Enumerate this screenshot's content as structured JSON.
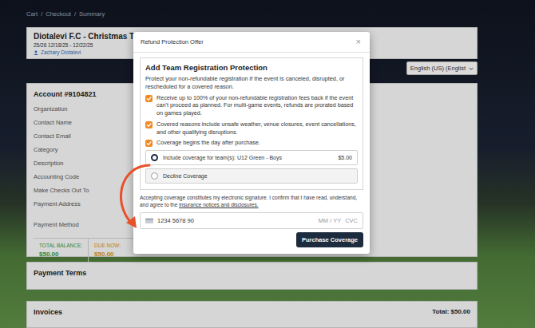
{
  "breadcrumb": {
    "items": [
      "Cart",
      "Checkout",
      "Summary"
    ],
    "separator": "/"
  },
  "event": {
    "title": "Diotalevi F.C - Christmas Tourn",
    "dates": "25/26 12/18/25 - 12/22/25",
    "owner": "Zachary Diotalevi"
  },
  "language": {
    "value": "English (US) (Englist"
  },
  "account": {
    "title": "Account #9104821",
    "fields": [
      "Organization",
      "Contact Name",
      "Contact Email",
      "Category",
      "Description",
      "Accounting Code",
      "Make Checks Out To",
      "Payment Address",
      "Payment Method"
    ],
    "balances": [
      {
        "label": "TOTAL BALANCE:",
        "value": "$50.00",
        "color": "#3a9a3a"
      },
      {
        "label": "DUE NOW:",
        "value": "$50.00",
        "color": "#d4921c"
      }
    ]
  },
  "payment_terms": {
    "title": "Payment Terms"
  },
  "invoices": {
    "title": "Invoices",
    "total": "Total: $50.00"
  },
  "modal": {
    "title": "Refund Protection Offer",
    "close": "×",
    "heading": "Add Team Registration Protection",
    "description": "Protect your non-refundable registration if the event is canceled, disrupted, or rescheduled for a covered reason.",
    "benefits": [
      "Receive up to 100% of your non-refundable registration fees back if the event can't proceed as planned. For multi-game events, refunds are prorated based on games played.",
      "Covered reasons include unsafe weather, venue closures, event cancellations, and other qualifying disruptions.",
      "Coverage begins the day after purchase."
    ],
    "options": [
      {
        "label": "Include coverage for team(s): U12 Green - Boys",
        "price": "$5.00",
        "selected": true
      },
      {
        "label": "Decline Coverage",
        "price": "",
        "selected": false
      }
    ],
    "consent": {
      "text": "Accepting coverage constitutes my electronic signature. I confirm that I have read, understand, and agree to the",
      "link": "insurance notices and disclosures."
    },
    "card": {
      "number": "1234 5678 90",
      "expiry_placeholder": "MM / YY",
      "cvc_placeholder": "CVC"
    },
    "button": "Purchase Coverage"
  }
}
